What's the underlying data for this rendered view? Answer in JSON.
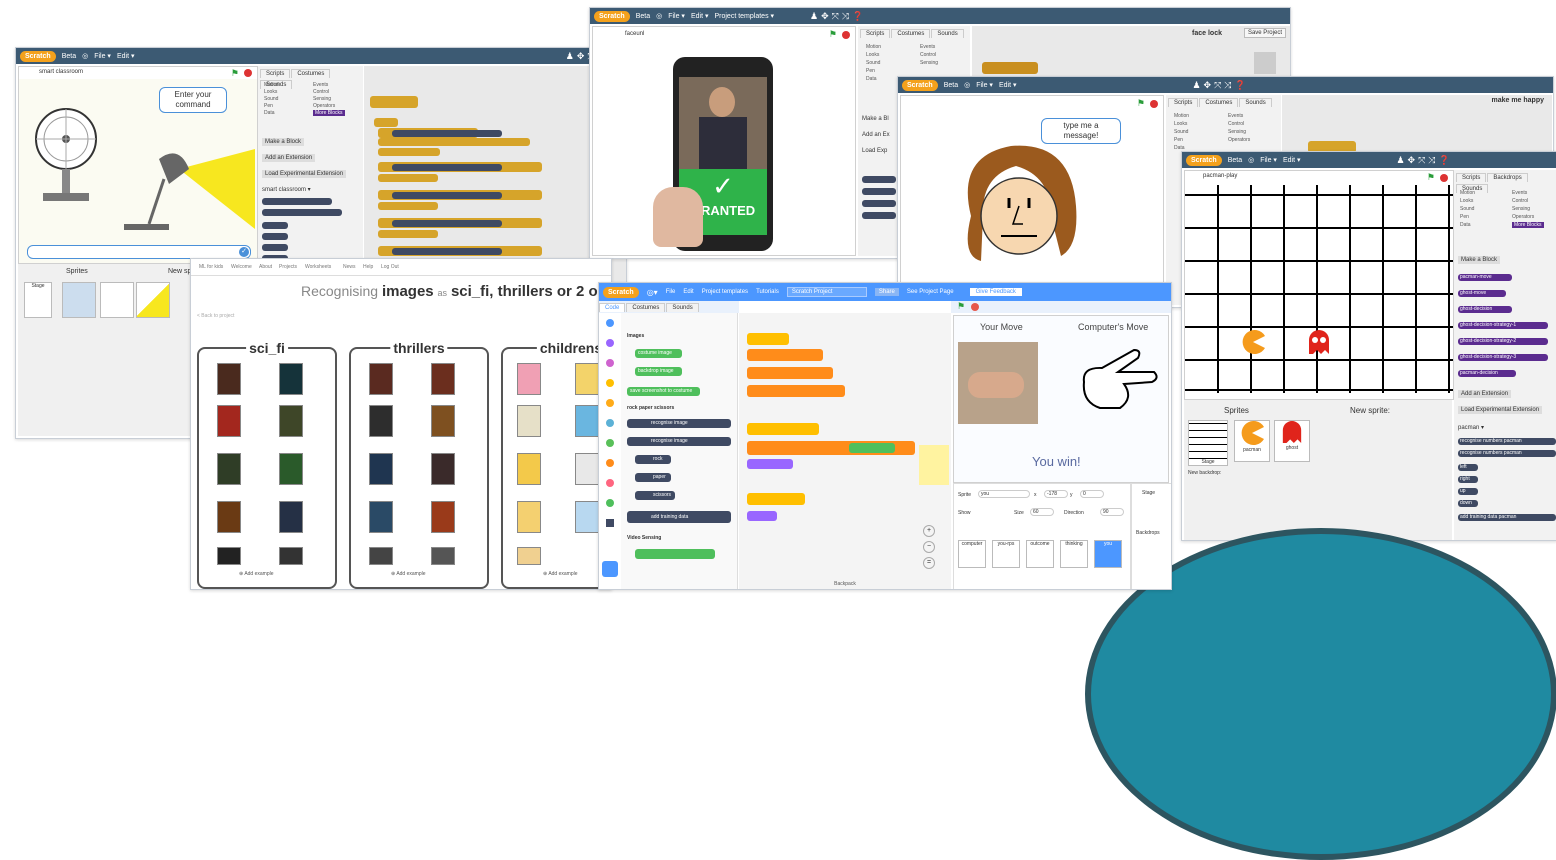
{
  "logo_text": "Scratch",
  "win1": {
    "menu": [
      "Beta",
      "File ▾",
      "Edit ▾"
    ],
    "project_name": "smart classroom",
    "tabs": [
      "Scripts",
      "Costumes",
      "Sounds"
    ],
    "categories_left": [
      "Motion",
      "Looks",
      "Sound",
      "Pen",
      "Data"
    ],
    "categories_right": [
      "Events",
      "Control",
      "Sensing",
      "Operators",
      "More Blocks"
    ],
    "bubble": "Enter your command",
    "side_buttons": [
      "Make a Block",
      "Add an Extension",
      "Load Experimental Extension"
    ],
    "ext_label": "smart classroom ▾",
    "sprites_label": "Sprites",
    "new_sprite_label": "New sp",
    "stage_label": "Stage"
  },
  "win2": {
    "menu": [
      "Beta",
      "File ▾",
      "Edit ▾",
      "Project templates ▾"
    ],
    "project_name": "faceunl",
    "tabs": [
      "Scripts",
      "Costumes",
      "Sounds"
    ],
    "categories_left": [
      "Motion",
      "Looks",
      "Sound",
      "Pen",
      "Data"
    ],
    "categories_right": [
      "Events",
      "Control",
      "Sensing"
    ],
    "granted_text": "GRANTED",
    "face_lock_label": "face lock",
    "save_button": "Save Project",
    "side_buttons": [
      "Make a Bl",
      "Add an Ex",
      "Load Exp"
    ]
  },
  "win3": {
    "menu": [
      "Beta",
      "File ▾",
      "Edit ▾"
    ],
    "tabs": [
      "Scripts",
      "Costumes",
      "Sounds"
    ],
    "categories_left": [
      "Motion",
      "Looks",
      "Sound",
      "Pen",
      "Data"
    ],
    "categories_right": [
      "Events",
      "Control",
      "Sensing",
      "Operators"
    ],
    "bubble": "type me a message!",
    "title_right": "make me happy"
  },
  "win4": {
    "menu": [
      "Beta",
      "File ▾",
      "Edit ▾"
    ],
    "project_name": "pacman-play",
    "tabs": [
      "Scripts",
      "Backdrops",
      "Sounds"
    ],
    "categories_left": [
      "Motion",
      "Looks",
      "Sound",
      "Pen",
      "Data"
    ],
    "categories_right": [
      "Events",
      "Control",
      "Sensing",
      "Operators",
      "More Blocks"
    ],
    "blocks": [
      "pacman-move",
      "ghost-move",
      "ghost-decision",
      "ghost-decision-strategy-1",
      "ghost-decision-strategy-2",
      "ghost-decision-strategy-3",
      "pacman-decision"
    ],
    "side_buttons": [
      "Make a Block",
      "Add an Extension",
      "Load Experimental Extension"
    ],
    "ext_label": "pacman ▾",
    "sprite_blocks": [
      "recognise numbers pacman",
      "recognise numbers pacman",
      "left",
      "right",
      "up",
      "down",
      "add training data pacman"
    ],
    "sprites_label": "Sprites",
    "new_sprite_label": "New sprite:",
    "sprites": [
      "Stage",
      "pacman",
      "ghost"
    ],
    "new_backdrop_label": "New backdrop:"
  },
  "win5": {
    "nav": [
      "ML for kids",
      "Welcome",
      "About",
      "Projects",
      "Worksheets",
      "News",
      "Help",
      "Log Out"
    ],
    "heading_pre": "Recognising",
    "heading_key": "images",
    "heading_as": "as",
    "heading_tail": "sci_fi, thrillers or 2 o",
    "back_link": "< Back to project",
    "columns": [
      "sci_fi",
      "thrillers",
      "childrens"
    ],
    "add_example": "Add example"
  },
  "win6": {
    "menu": [
      "File",
      "Edit",
      "Project templates",
      "Tutorials"
    ],
    "project_name": "Scratch Project",
    "share": "Share",
    "see_project_page": "See Project Page",
    "give_feedback": "Give Feedback",
    "tabs": [
      "Code",
      "Costumes",
      "Sounds"
    ],
    "categories": [
      "Motion",
      "Looks",
      "Sound",
      "Events",
      "Control",
      "Sensing",
      "Operators",
      "Variables",
      "My Blocks",
      "Images",
      "rock paper scissors"
    ],
    "palette_heading1": "Images",
    "palette_blocks1": [
      "costume image",
      "backdrop image",
      "save screenshot to costume"
    ],
    "palette_heading2": "rock paper scissors",
    "palette_blocks2": [
      "recognise image",
      "recognise image",
      "rock",
      "paper",
      "scissors",
      "add training data"
    ],
    "palette_heading3": "Video Sensing",
    "your_move": "Your Move",
    "computer_move": "Computer's Move",
    "result": "You win!",
    "sprite_label": "Sprite",
    "sprite_value": "you",
    "x_label": "x",
    "x_value": "-178",
    "y_label": "y",
    "y_value": "0",
    "show_label": "Show",
    "size_label": "Size",
    "size_value": "60",
    "direction_label": "Direction",
    "direction_value": "90",
    "stage_label": "Stage",
    "backdrops_label": "Backdrops",
    "sprite_names": [
      "computer",
      "you-rps",
      "outcome",
      "thinking",
      "you"
    ],
    "backpack": "Backpack"
  },
  "colors": {
    "scratch_bar": "#3c5a73",
    "scratch3_bar": "#4c97ff",
    "granted_green": "#2fb34a",
    "teal_circle": "#1f8aa1"
  }
}
